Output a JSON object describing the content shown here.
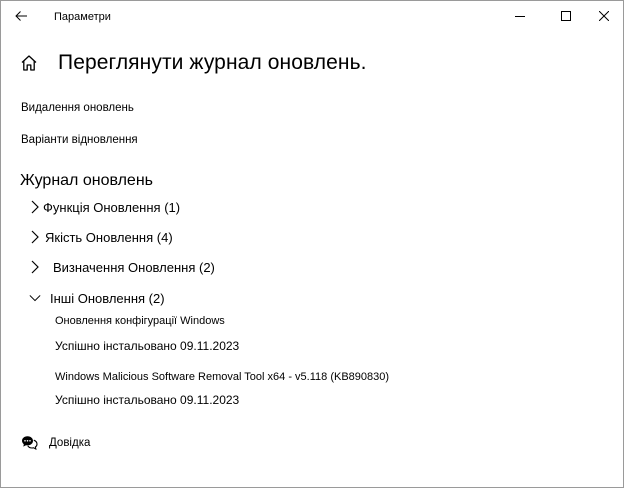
{
  "window": {
    "title": "Параметри",
    "icons": {
      "back": "back-arrow-icon",
      "minimize": "minimize-icon",
      "maximize": "maximize-icon",
      "close": "close-icon"
    }
  },
  "header": {
    "home_icon": "home-icon",
    "title": "Переглянути журнал оновлень."
  },
  "links": {
    "uninstall": "Видалення оновлень",
    "recovery": "Варіанти відновлення"
  },
  "history": {
    "title": "Журнал оновлень",
    "groups": [
      {
        "label": "Функція Оновлення (1)",
        "expanded": false
      },
      {
        "label": "Якість Оновлення (4)",
        "expanded": false
      },
      {
        "label": "Визначення Оновлення (2)",
        "expanded": false
      },
      {
        "label": "Інші Оновлення (2)",
        "expanded": true
      }
    ],
    "other_items": [
      {
        "name": "Оновлення конфігурації Windows",
        "status": "Успішно інстальовано 09.11.2023"
      },
      {
        "name": "Windows Malicious Software Removal Tool x64 - v5.118 (KB890830)",
        "status": "Успішно інстальовано 09.11.2023"
      }
    ]
  },
  "help": {
    "icon": "help-chat-icon",
    "label": "Довідка"
  }
}
